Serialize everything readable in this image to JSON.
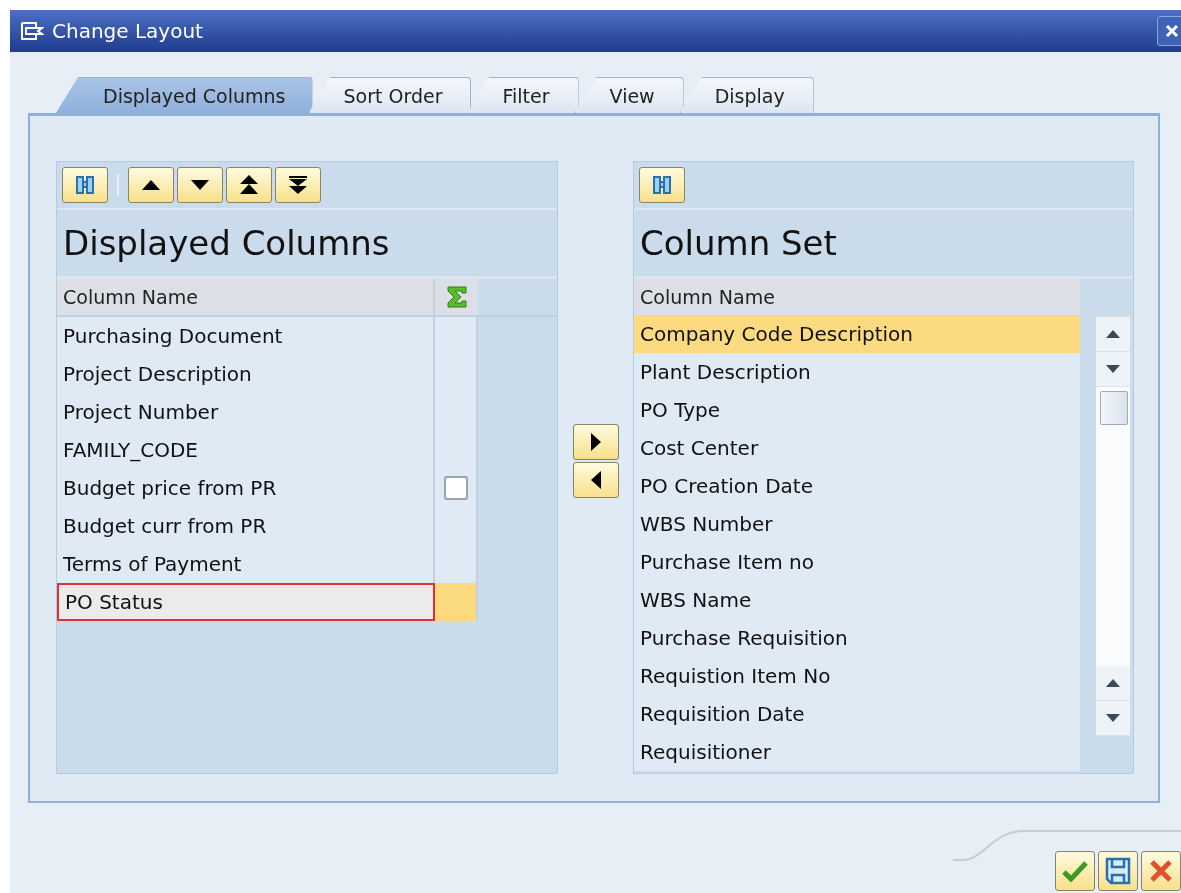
{
  "window": {
    "title": "Change Layout"
  },
  "tabs": [
    {
      "label": "Displayed Columns",
      "selected": true
    },
    {
      "label": "Sort Order",
      "selected": false
    },
    {
      "label": "Filter",
      "selected": false
    },
    {
      "label": "View",
      "selected": false
    },
    {
      "label": "Display",
      "selected": false
    }
  ],
  "displayed_columns": {
    "title": "Displayed Columns",
    "header": "Column Name",
    "rows": [
      {
        "name": "Purchasing Document",
        "kind": "text",
        "selected": false
      },
      {
        "name": "Project Description",
        "kind": "text",
        "selected": false
      },
      {
        "name": "Project Number",
        "kind": "text",
        "selected": false
      },
      {
        "name": "FAMILY_CODE",
        "kind": "text",
        "selected": false
      },
      {
        "name": "Budget price from PR",
        "kind": "checkbox",
        "checked": false,
        "selected": false
      },
      {
        "name": "Budget curr from PR",
        "kind": "text",
        "selected": false
      },
      {
        "name": "Terms of Payment",
        "kind": "text",
        "selected": false
      },
      {
        "name": "PO Status",
        "kind": "text",
        "selected": true
      }
    ]
  },
  "column_set": {
    "title": "Column Set",
    "header": "Column Name",
    "rows": [
      {
        "name": "Company Code Description",
        "selected": true
      },
      {
        "name": "Plant Description",
        "selected": false
      },
      {
        "name": "PO Type",
        "selected": false
      },
      {
        "name": "Cost Center",
        "selected": false
      },
      {
        "name": "PO Creation Date",
        "selected": false
      },
      {
        "name": "WBS Number",
        "selected": false
      },
      {
        "name": "Purchase Item no",
        "selected": false
      },
      {
        "name": "WBS Name",
        "selected": false
      },
      {
        "name": "Purchase Requisition",
        "selected": false
      },
      {
        "name": "Requistion Item No",
        "selected": false
      },
      {
        "name": "Requisition Date",
        "selected": false
      },
      {
        "name": "Requisitioner",
        "selected": false
      }
    ]
  }
}
